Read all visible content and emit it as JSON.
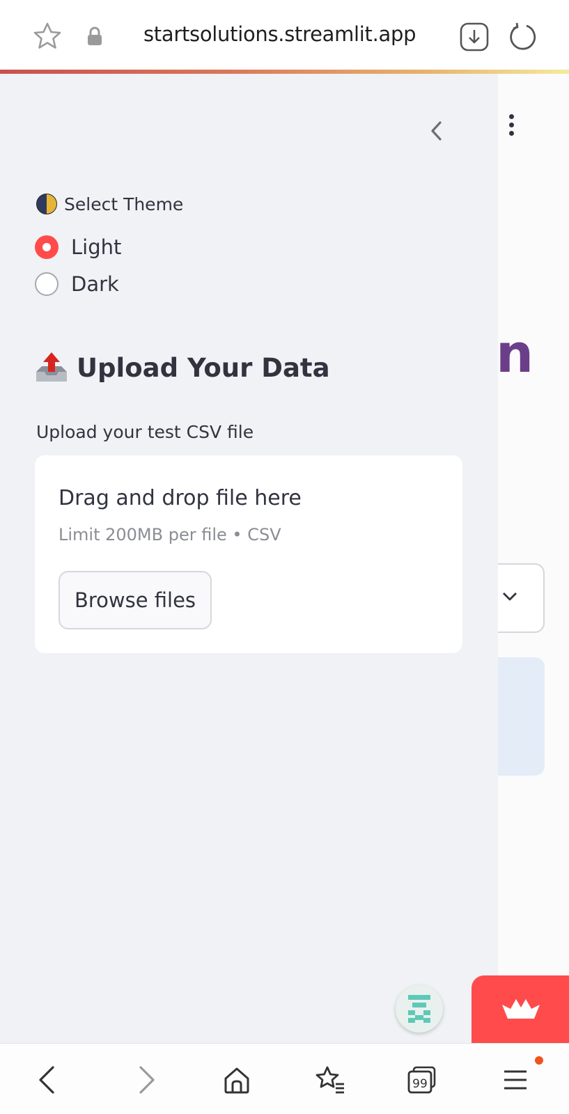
{
  "browser": {
    "url": "startsolutions.streamlit.app",
    "tab_count": "99"
  },
  "sidebar": {
    "theme_label": "Select Theme",
    "theme_options": [
      {
        "label": "Light",
        "selected": true
      },
      {
        "label": "Dark",
        "selected": false
      }
    ],
    "upload_heading": "Upload Your Data",
    "upload_label": "Upload your test CSV file",
    "dropzone": {
      "title": "Drag and drop file here",
      "subtitle": "Limit 200MB per file • CSV",
      "button": "Browse files"
    }
  },
  "main": {
    "title_fragment": "n"
  },
  "colors": {
    "accent": "#ff4b4b",
    "title": "#6b3e8a",
    "sidebar_bg": "#f0f2f6"
  }
}
